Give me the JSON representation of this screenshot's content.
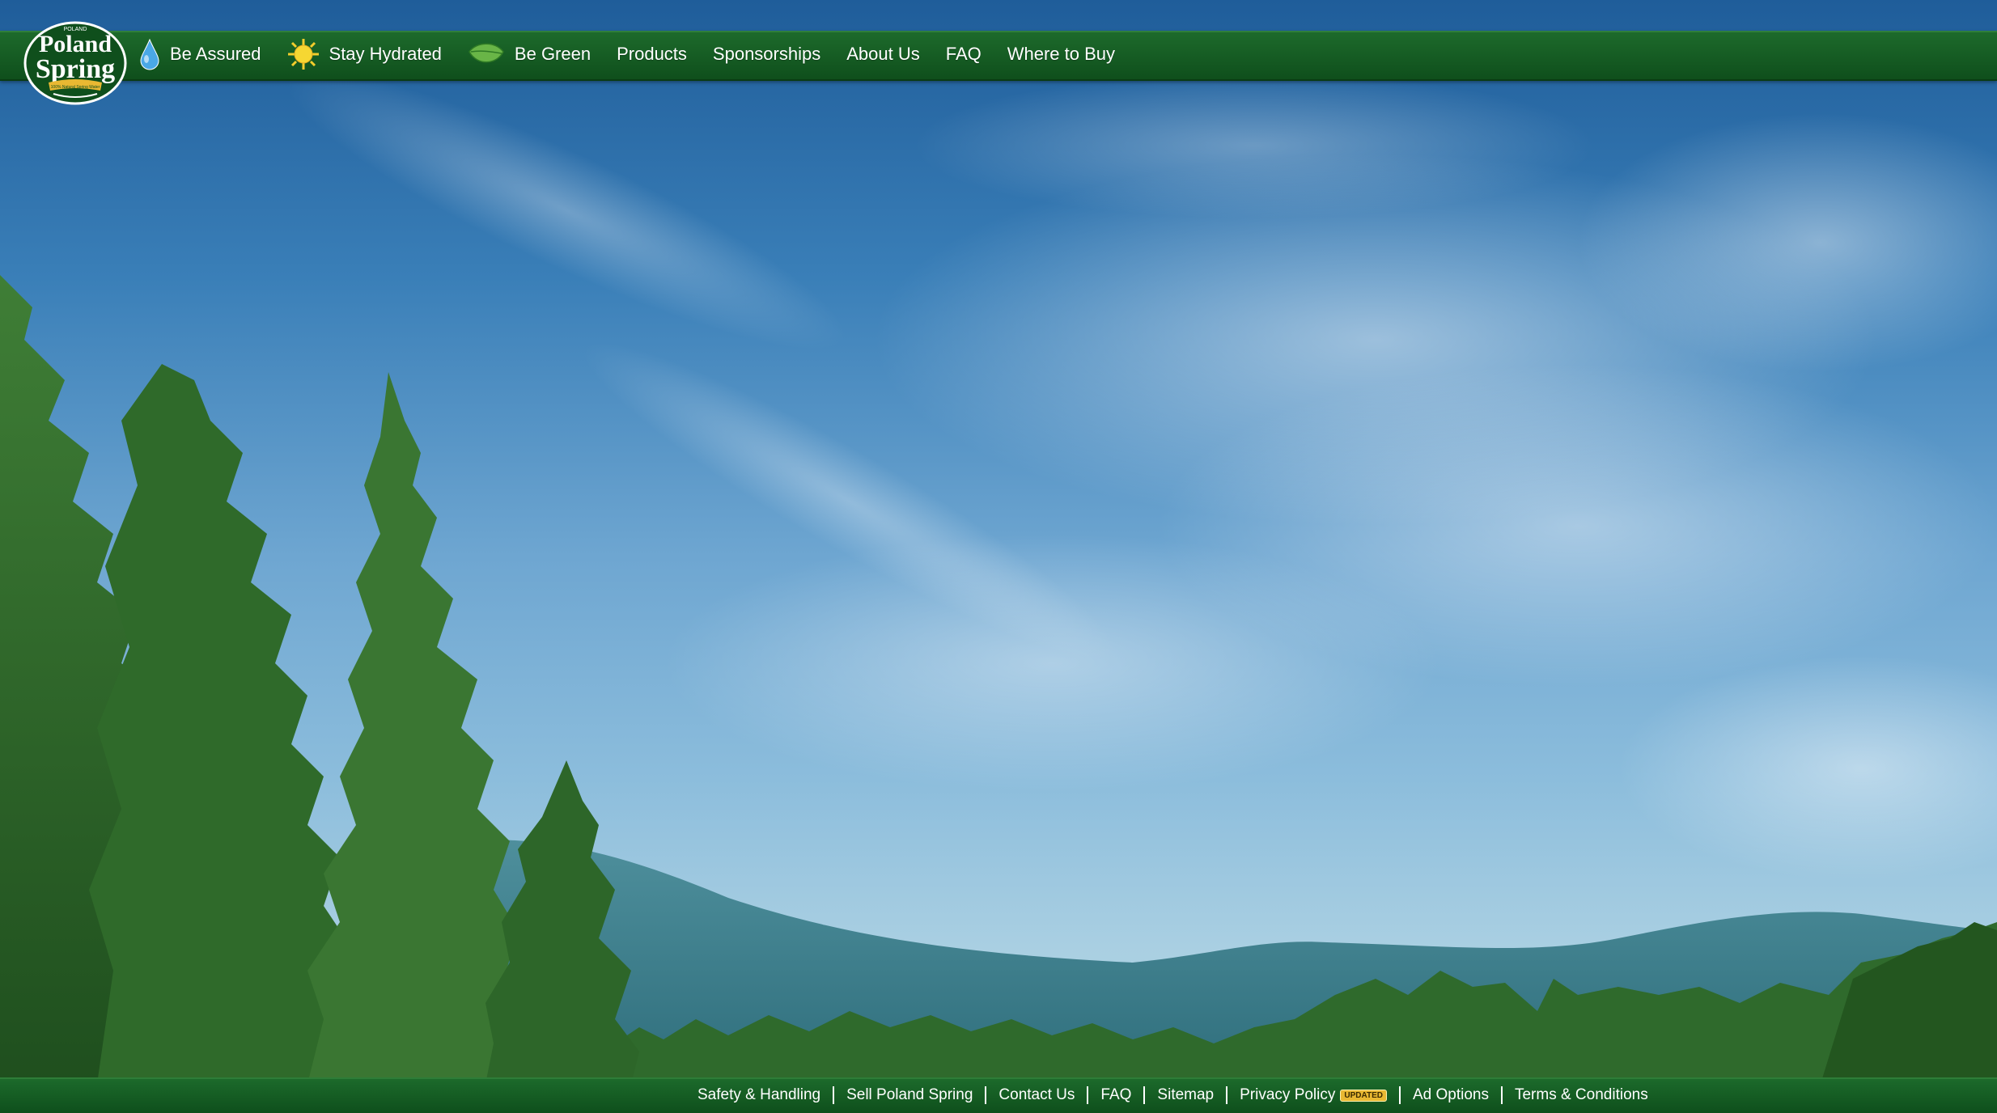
{
  "brand": {
    "logo_top": "POLAND",
    "logo_name_1": "Poland",
    "logo_name_2": "Spring",
    "logo_ribbon": "100% Natural Spring Water"
  },
  "nav": {
    "items": [
      {
        "label": "Be Assured",
        "icon": "water-drop-icon"
      },
      {
        "label": "Stay Hydrated",
        "icon": "sun-icon"
      },
      {
        "label": "Be Green",
        "icon": "leaf-icon"
      },
      {
        "label": "Products"
      },
      {
        "label": "Sponsorships"
      },
      {
        "label": "About Us"
      },
      {
        "label": "FAQ"
      },
      {
        "label": "Where to Buy"
      }
    ]
  },
  "footer": {
    "links": [
      {
        "label": "Safety & Handling"
      },
      {
        "label": "Sell Poland Spring"
      },
      {
        "label": "Contact Us"
      },
      {
        "label": "FAQ"
      },
      {
        "label": "Sitemap"
      },
      {
        "label": "Privacy Policy",
        "badge": "UPDATED"
      },
      {
        "label": "Ad Options"
      },
      {
        "label": "Terms & Conditions"
      }
    ]
  },
  "colors": {
    "nav_green": "#0f4f1c",
    "badge_yellow": "#e9b832",
    "sky_blue": "#3a7fb8"
  }
}
